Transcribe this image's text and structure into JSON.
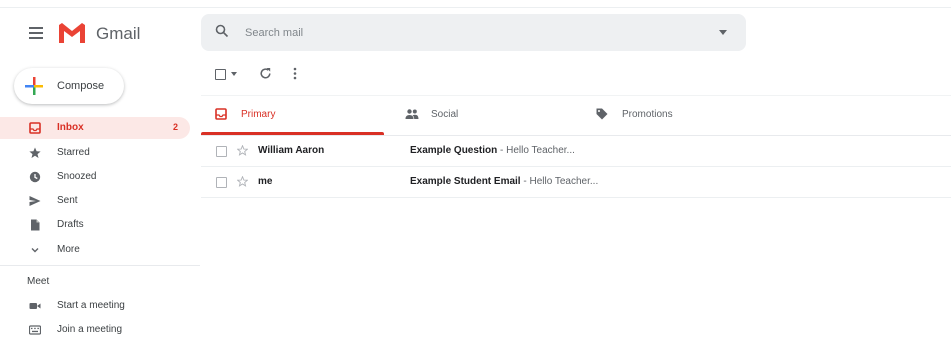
{
  "header": {
    "brand": "Gmail",
    "search_placeholder": "Search mail"
  },
  "compose_label": "Compose",
  "sidebar": {
    "items": [
      {
        "label": "Inbox",
        "count": "2"
      },
      {
        "label": "Starred"
      },
      {
        "label": "Snoozed"
      },
      {
        "label": "Sent"
      },
      {
        "label": "Drafts"
      },
      {
        "label": "More"
      }
    ],
    "meet": {
      "heading": "Meet",
      "items": [
        {
          "label": "Start a meeting"
        },
        {
          "label": "Join a meeting"
        }
      ]
    }
  },
  "tabs": [
    {
      "label": "Primary",
      "icon": "inbox-icon"
    },
    {
      "label": "Social",
      "icon": "people-icon"
    },
    {
      "label": "Promotions",
      "icon": "tag-icon"
    }
  ],
  "emails": [
    {
      "sender": "William Aaron",
      "subject": "Example Question",
      "snippet": " - Hello Teacher..."
    },
    {
      "sender": "me",
      "subject": "Example Student Email",
      "snippet": " - Hello Teacher..."
    }
  ],
  "colors": {
    "accent_red": "#d93025",
    "active_bg": "#fce8e6",
    "search_bg": "#eef0f2"
  }
}
